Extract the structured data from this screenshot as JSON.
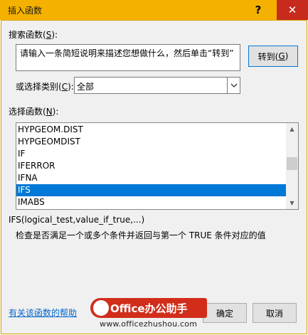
{
  "window": {
    "title": "插入函数",
    "help_glyph": "?",
    "close_glyph": "✕"
  },
  "search": {
    "label_prefix": "搜索函数(",
    "label_key": "S",
    "label_suffix": "):",
    "value": "请输入一条简短说明来描述您想做什么，然后单击“转到”",
    "goto_prefix": "转到(",
    "goto_key": "G",
    "goto_suffix": ")"
  },
  "category": {
    "label_prefix": "或选择类别(",
    "label_key": "C",
    "label_suffix": "):",
    "selected": "全部"
  },
  "functions": {
    "label_prefix": "选择函数(",
    "label_key": "N",
    "label_suffix": "):",
    "items": [
      "HYPGEOM.DIST",
      "HYPGEOMDIST",
      "IF",
      "IFERROR",
      "IFNA",
      "IFS",
      "IMABS"
    ],
    "selected_index": 5
  },
  "detail": {
    "signature": "IFS(logical_test,value_if_true,...)",
    "description": "检查是否满足一个或多个条件并返回与第一个 TRUE 条件对应的值"
  },
  "footer": {
    "help_link": "有关该函数的帮助",
    "ok_label": "确定",
    "cancel_label": "取消"
  },
  "watermark": {
    "brand": "Office办公助手",
    "url": "www.officezhushou.com"
  },
  "colors": {
    "title_bar": "#f4b100",
    "close_button": "#c72b1d",
    "selection": "#0078d7",
    "watermark": "#d12d1a"
  }
}
